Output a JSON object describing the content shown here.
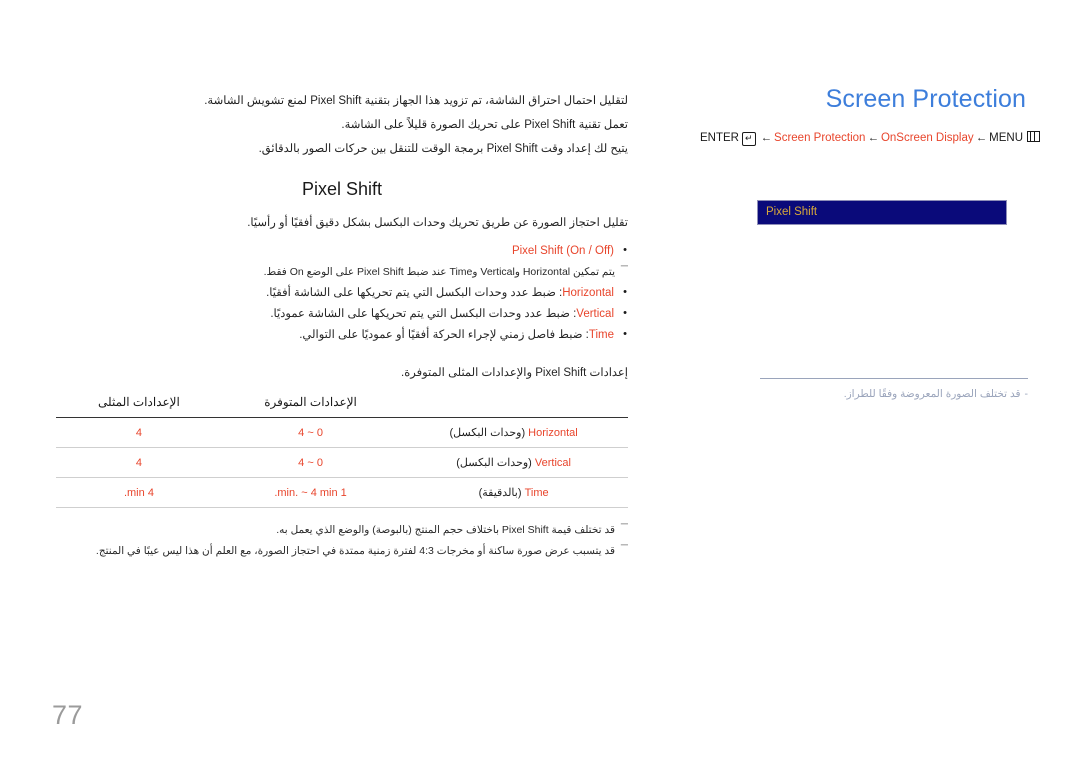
{
  "page": {
    "number": "77"
  },
  "header": {
    "title": "Screen Protection",
    "breadcrumb": {
      "enter_label": "ENTER",
      "enter_icon": "enter-key-icon",
      "items": [
        {
          "label": "Screen Protection",
          "highlight": true
        },
        {
          "label": "OnScreen Display",
          "highlight": true
        },
        {
          "label": "MENU",
          "highlight": false
        }
      ],
      "arrow": "←",
      "menu_icon": "menu-grid-icon"
    }
  },
  "osd": {
    "rows": [
      {
        "label": "Pixel Shift",
        "selected": true
      }
    ],
    "note": "قد تختلف الصورة المعروضة وفقًا للطراز.",
    "note_dash": "-"
  },
  "body": {
    "intro": [
      "لتقليل احتمال احتراق الشاشة، تم تزويد هذا الجهاز بتقنية Pixel Shift لمنع تشويش الشاشة.",
      "تعمل تقنية Pixel Shift على تحريك الصورة قليلاً على الشاشة.",
      "يتيح لك إعداد وقت Pixel Shift برمجة الوقت للتنقل بين حركات الصور بالدقائق."
    ],
    "section_title": "Pixel Shift",
    "lead": "تقليل احتجاز الصورة عن طريق تحريك وحدات البكسل بشكل دقيق أفقيًا أو رأسيًا.",
    "bullets": [
      "Pixel Shift (On / Off)"
    ],
    "note_after_first_bullet": "يتم تمكين Horizontal وVertical وTime عند ضبط Pixel Shift على الوضع On فقط.",
    "option_bullets": [
      {
        "term": "Horizontal",
        "desc": ": ضبط عدد وحدات البكسل التي يتم تحريكها على الشاشة أفقيًا."
      },
      {
        "term": "Vertical",
        "desc": ": ضبط عدد وحدات البكسل التي يتم تحريكها على الشاشة عموديًا."
      },
      {
        "term": "Time",
        "desc": ": ضبط فاصل زمني لإجراء الحركة أفقيًا أو عموديًا على التوالي."
      }
    ],
    "table_intro": "إعدادات Pixel Shift والإعدادات المثلى المتوفرة.",
    "bottom_notes": [
      "قد تختلف قيمة Pixel Shift باختلاف حجم المنتج (بالبوصة) والوضع الذي يعمل به.",
      "قد يتسبب عرض صورة ساكنة أو مخرجات 4:3 لفترة زمنية ممتدة في احتجاز الصورة، مع العلم أن هذا ليس عيبًا في المنتج."
    ]
  },
  "table": {
    "headers": {
      "label": "",
      "available": "الإعدادات المتوفرة",
      "optimal": "الإعدادات المثلى"
    },
    "rows": [
      {
        "term": "Horizontal",
        "unit": "(وحدات البكسل)",
        "available": "0 ~ 4",
        "optimal": "4"
      },
      {
        "term": "Vertical",
        "unit": "(وحدات البكسل)",
        "available": "0 ~ 4",
        "optimal": "4"
      },
      {
        "term": "Time",
        "unit": "(بالدقيقة)",
        "available": "1 min. ~ 4 min.",
        "optimal": "4 min."
      }
    ]
  },
  "colors": {
    "title_blue": "#3d7edb",
    "accent_orange": "#e8452c",
    "osd_bar_bg": "#0a0a7a",
    "osd_bar_text": "#d8a83a",
    "note_gray": "#9aa4bb",
    "page_number_gray": "#9b9b9b"
  }
}
